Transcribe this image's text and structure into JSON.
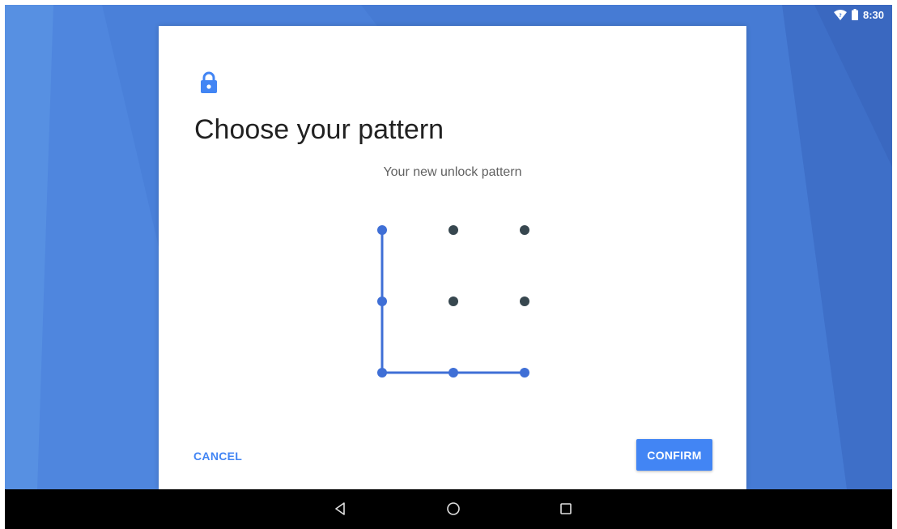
{
  "status_bar": {
    "time": "8:30",
    "wifi_icon": "wifi-icon",
    "battery_icon": "battery-icon"
  },
  "dialog": {
    "icon": "lock-icon",
    "title": "Choose your pattern",
    "subtitle": "Your new unlock pattern",
    "pattern": {
      "grid_size": 3,
      "selected_sequence": [
        1,
        4,
        7,
        8,
        9
      ]
    },
    "cancel_label": "CANCEL",
    "confirm_label": "CONFIRM"
  },
  "navigation": {
    "back_icon": "back-icon",
    "home_icon": "home-icon",
    "recents_icon": "recents-icon"
  },
  "colors": {
    "accent": "#4285f4",
    "pattern_line": "#3f6fd6",
    "dot_inactive": "#37474f",
    "wallpaper": "#4a80d9"
  }
}
